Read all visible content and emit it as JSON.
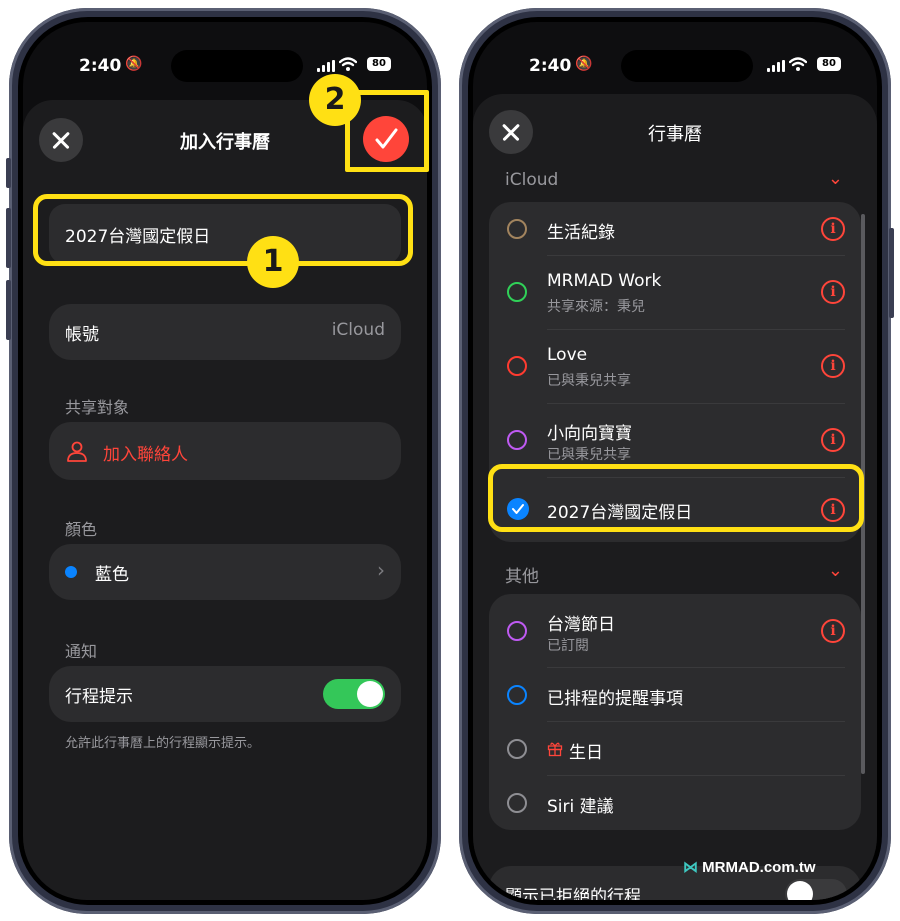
{
  "status": {
    "time": "2:40",
    "battery": "80"
  },
  "left": {
    "title": "加入行事曆",
    "name_value": "2027台灣國定假日",
    "badge1": "1",
    "badge2": "2",
    "account_label": "帳號",
    "account_value": "iCloud",
    "shared_header": "共享對象",
    "add_contact": "加入聯絡人",
    "color_header": "顏色",
    "color_value": "藍色",
    "notify_header": "通知",
    "alert_label": "行程提示",
    "alert_on": true,
    "footnote": "允許此行事曆上的行程顯示提示。",
    "colors": {
      "accent": "#ff453a",
      "blue": "#0a84ff",
      "green": "#34c759",
      "highlight": "#ffe014"
    }
  },
  "right": {
    "title": "行事曆",
    "icloud_header": "iCloud",
    "icloud_items": [
      {
        "title": "生活紀錄",
        "subtitle": "",
        "color": "#a2845e"
      },
      {
        "title": "MRMAD Work",
        "subtitle": "共享來源：秉兒",
        "color": "#30d158"
      },
      {
        "title": "Love",
        "subtitle": "已與秉兒共享",
        "color": "#ff3b30"
      },
      {
        "title": "小向向寶寶",
        "subtitle": "已與秉兒共享",
        "color": "#bf5af2"
      },
      {
        "title": "2027台灣國定假日",
        "subtitle": "",
        "color": "#0a84ff",
        "checked": true
      }
    ],
    "other_header": "其他",
    "other_items": [
      {
        "title": "台灣節日",
        "subtitle": "已訂閱",
        "color": "#bf5af2"
      },
      {
        "title": "已排程的提醒事項",
        "subtitle": "",
        "color": "#0a84ff"
      },
      {
        "title": "生日",
        "subtitle": "",
        "color": "#8e8e93",
        "icon": "gift-icon"
      },
      {
        "title": "Siri 建議",
        "subtitle": "",
        "color": "#8e8e93"
      }
    ],
    "declined_label": "顯示已拒絕的行程",
    "declined_on": false,
    "watermark": "MRMAD.com.tw"
  }
}
